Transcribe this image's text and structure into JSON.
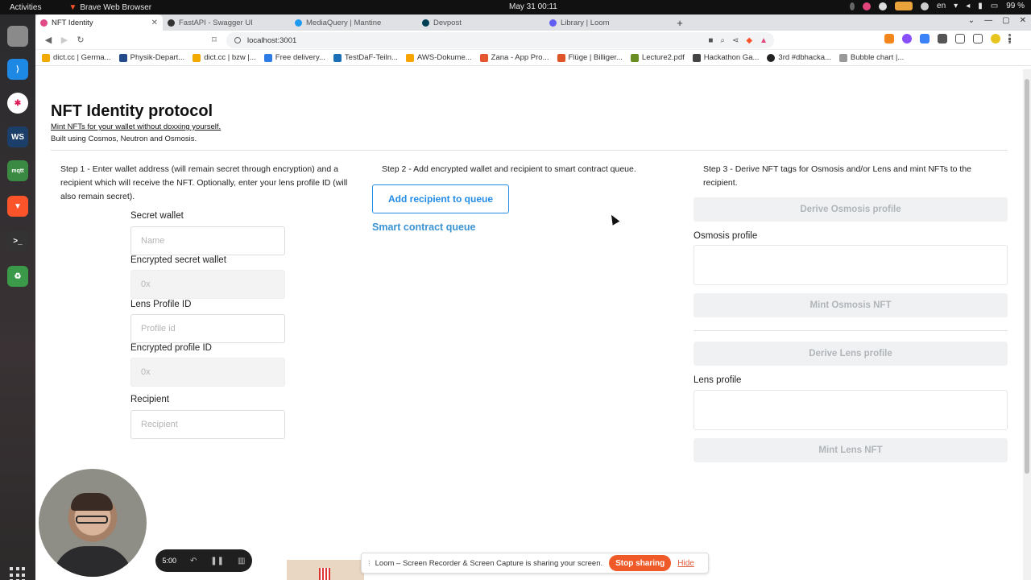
{
  "system": {
    "activities": "Activities",
    "app_name": "Brave Web Browser",
    "clock": "May 31  00:11",
    "lang": "en",
    "battery": "99 %"
  },
  "tabs": [
    {
      "label": "NFT Identity",
      "active": true,
      "color": "#e04b87"
    },
    {
      "label": "FastAPI - Swagger UI",
      "active": false,
      "color": "#333333"
    },
    {
      "label": "MediaQuery | Mantine",
      "active": false,
      "color": "#1d9bf0"
    },
    {
      "label": "Devpost",
      "active": false,
      "color": "#003e54"
    },
    {
      "label": "Library | Loom",
      "active": false,
      "color": "#625df5"
    }
  ],
  "address_bar": {
    "url": "localhost:3001"
  },
  "bookmarks": [
    {
      "label": "dict.cc | Germa...",
      "color": "#f2a900"
    },
    {
      "label": "Physik-Depart...",
      "color": "#234b8c"
    },
    {
      "label": "dict.cc | bzw |...",
      "color": "#f2a900"
    },
    {
      "label": "Free delivery...",
      "color": "#2d7be5"
    },
    {
      "label": "TestDaF-Teiln...",
      "color": "#1a6fb5"
    },
    {
      "label": "AWS-Dokume...",
      "color": "#f7a400"
    },
    {
      "label": "Zana - App Pro...",
      "color": "#e5572e"
    },
    {
      "label": "Flüge | Billiger...",
      "color": "#e0542a"
    },
    {
      "label": "Lecture2.pdf",
      "color": "#6b8e23"
    },
    {
      "label": "Hackathon Ga...",
      "color": "#444444"
    },
    {
      "label": "3rd #dbhacka...",
      "color": "#222222"
    },
    {
      "label": "Bubble chart |...",
      "color": "#999999"
    }
  ],
  "page": {
    "title": "NFT Identity protocol",
    "subtitle": "Mint NFTs for your wallet without doxxing yourself.",
    "built_with": "Built using Cosmos, Neutron and Osmosis.",
    "step1": {
      "text": "Step 1 - Enter wallet address (will remain secret through encryption) and a recipient which will receive the NFT. Optionally, enter your lens profile ID (will also remain secret).",
      "secret_wallet_label": "Secret wallet",
      "secret_wallet_placeholder": "Name",
      "encrypted_wallet_label": "Encrypted secret wallet",
      "encrypted_wallet_placeholder": "0x",
      "lens_id_label": "Lens Profile ID",
      "lens_id_placeholder": "Profile id",
      "encrypted_profile_label": "Encrypted profile ID",
      "encrypted_profile_placeholder": "0x",
      "recipient_label": "Recipient",
      "recipient_placeholder": "Recipient"
    },
    "step2": {
      "text": "Step 2 - Add encrypted wallet and recipient to smart contract queue.",
      "add_button": "Add recipient to queue",
      "queue_link": "Smart contract queue"
    },
    "step3": {
      "text": "Step 3 - Derive NFT tags for Osmosis and/or Lens and mint NFTs to the recipient.",
      "derive_osmosis": "Derive Osmosis profile",
      "osmosis_label": "Osmosis profile",
      "mint_osmosis": "Mint Osmosis NFT",
      "derive_lens": "Derive Lens profile",
      "lens_label": "Lens profile",
      "mint_lens": "Mint Lens NFT"
    }
  },
  "loom": {
    "timer": "5:00",
    "share_text": "Loom – Screen Recorder & Screen Capture is sharing your screen.",
    "stop": "Stop sharing",
    "hide": "Hide"
  },
  "colors": {
    "accent": "#228be6",
    "disabled_bg": "#f0f1f3",
    "loom_stop": "#f05a28"
  }
}
